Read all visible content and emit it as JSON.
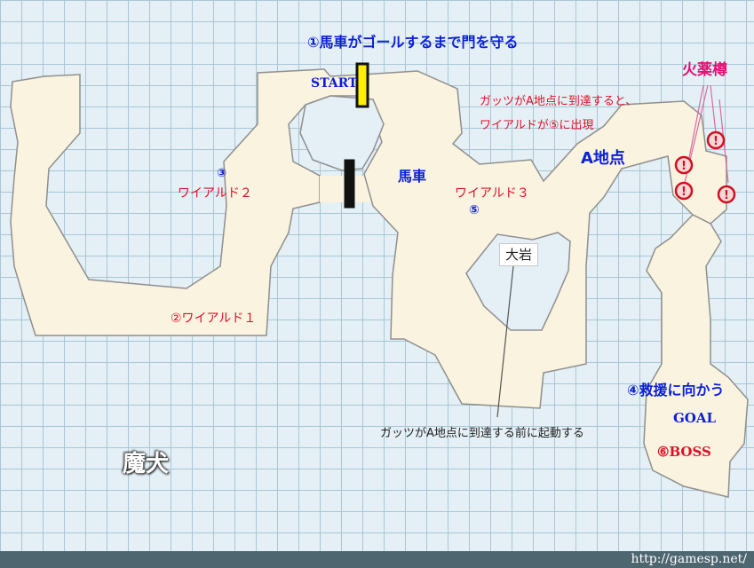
{
  "objective": "①馬車がゴールするまで門を守る",
  "start_label": "START",
  "wagon_label": "馬車",
  "wild": {
    "w1": "②ワイアルド１",
    "w2_num": "③",
    "w2": "ワイアルド２",
    "w3": "ワイアルド３",
    "w3_num": "⑤"
  },
  "point_a": "A地点",
  "note_arrival": [
    "ガッツがA地点に到達すると、",
    "ワイアルドが⑤に出現"
  ],
  "gunpowder_label": "火薬樽",
  "gunpowder_count": 4,
  "rock_label": "大岩",
  "rock_note": "ガッツがA地点に到達する前に起動する",
  "rescue": "④救援に向かう",
  "goal_label": "GOAL",
  "boss_label": "⑥BOSS",
  "enemy_label": "魔犬",
  "footer_url": "http://gamesp.net/",
  "colors": {
    "path_fill": "#faf3df",
    "path_stroke": "#8f8f8f",
    "blue": "#0a1fd8",
    "red": "#e0102a",
    "pink": "#e60f74",
    "gate_yellow": "#ffee00"
  }
}
